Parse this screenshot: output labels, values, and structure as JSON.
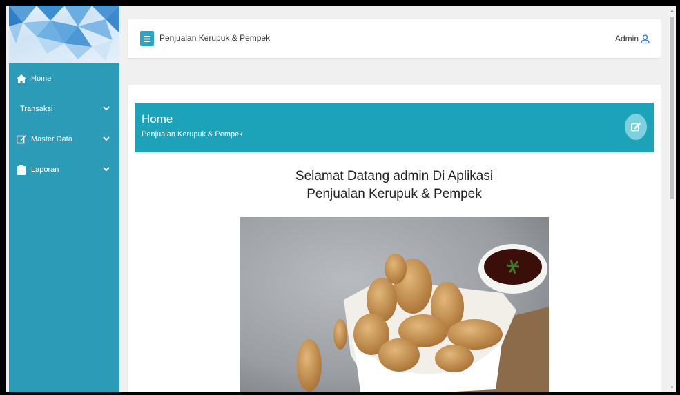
{
  "header": {
    "app_title": "Penjualan Kerupuk & Pempek",
    "user_label": "Admin"
  },
  "sidebar": {
    "items": [
      {
        "label": "Home",
        "icon": "home-icon"
      },
      {
        "label": "Transaksi",
        "icon": "none"
      },
      {
        "label": "Master Data",
        "icon": "edit-icon"
      },
      {
        "label": "Laporan",
        "icon": "clipboard-icon"
      }
    ]
  },
  "banner": {
    "title": "Home",
    "subtitle": "Penjualan Kerupuk & Pempek"
  },
  "welcome": {
    "line1": "Selamat Datang admin Di Aplikasi",
    "line2": "Penjualan Kerupuk & Pempek"
  },
  "colors": {
    "sidebar": "#2c9bb8",
    "banner": "#1ca3b9",
    "accent": "#2aa6c4"
  }
}
